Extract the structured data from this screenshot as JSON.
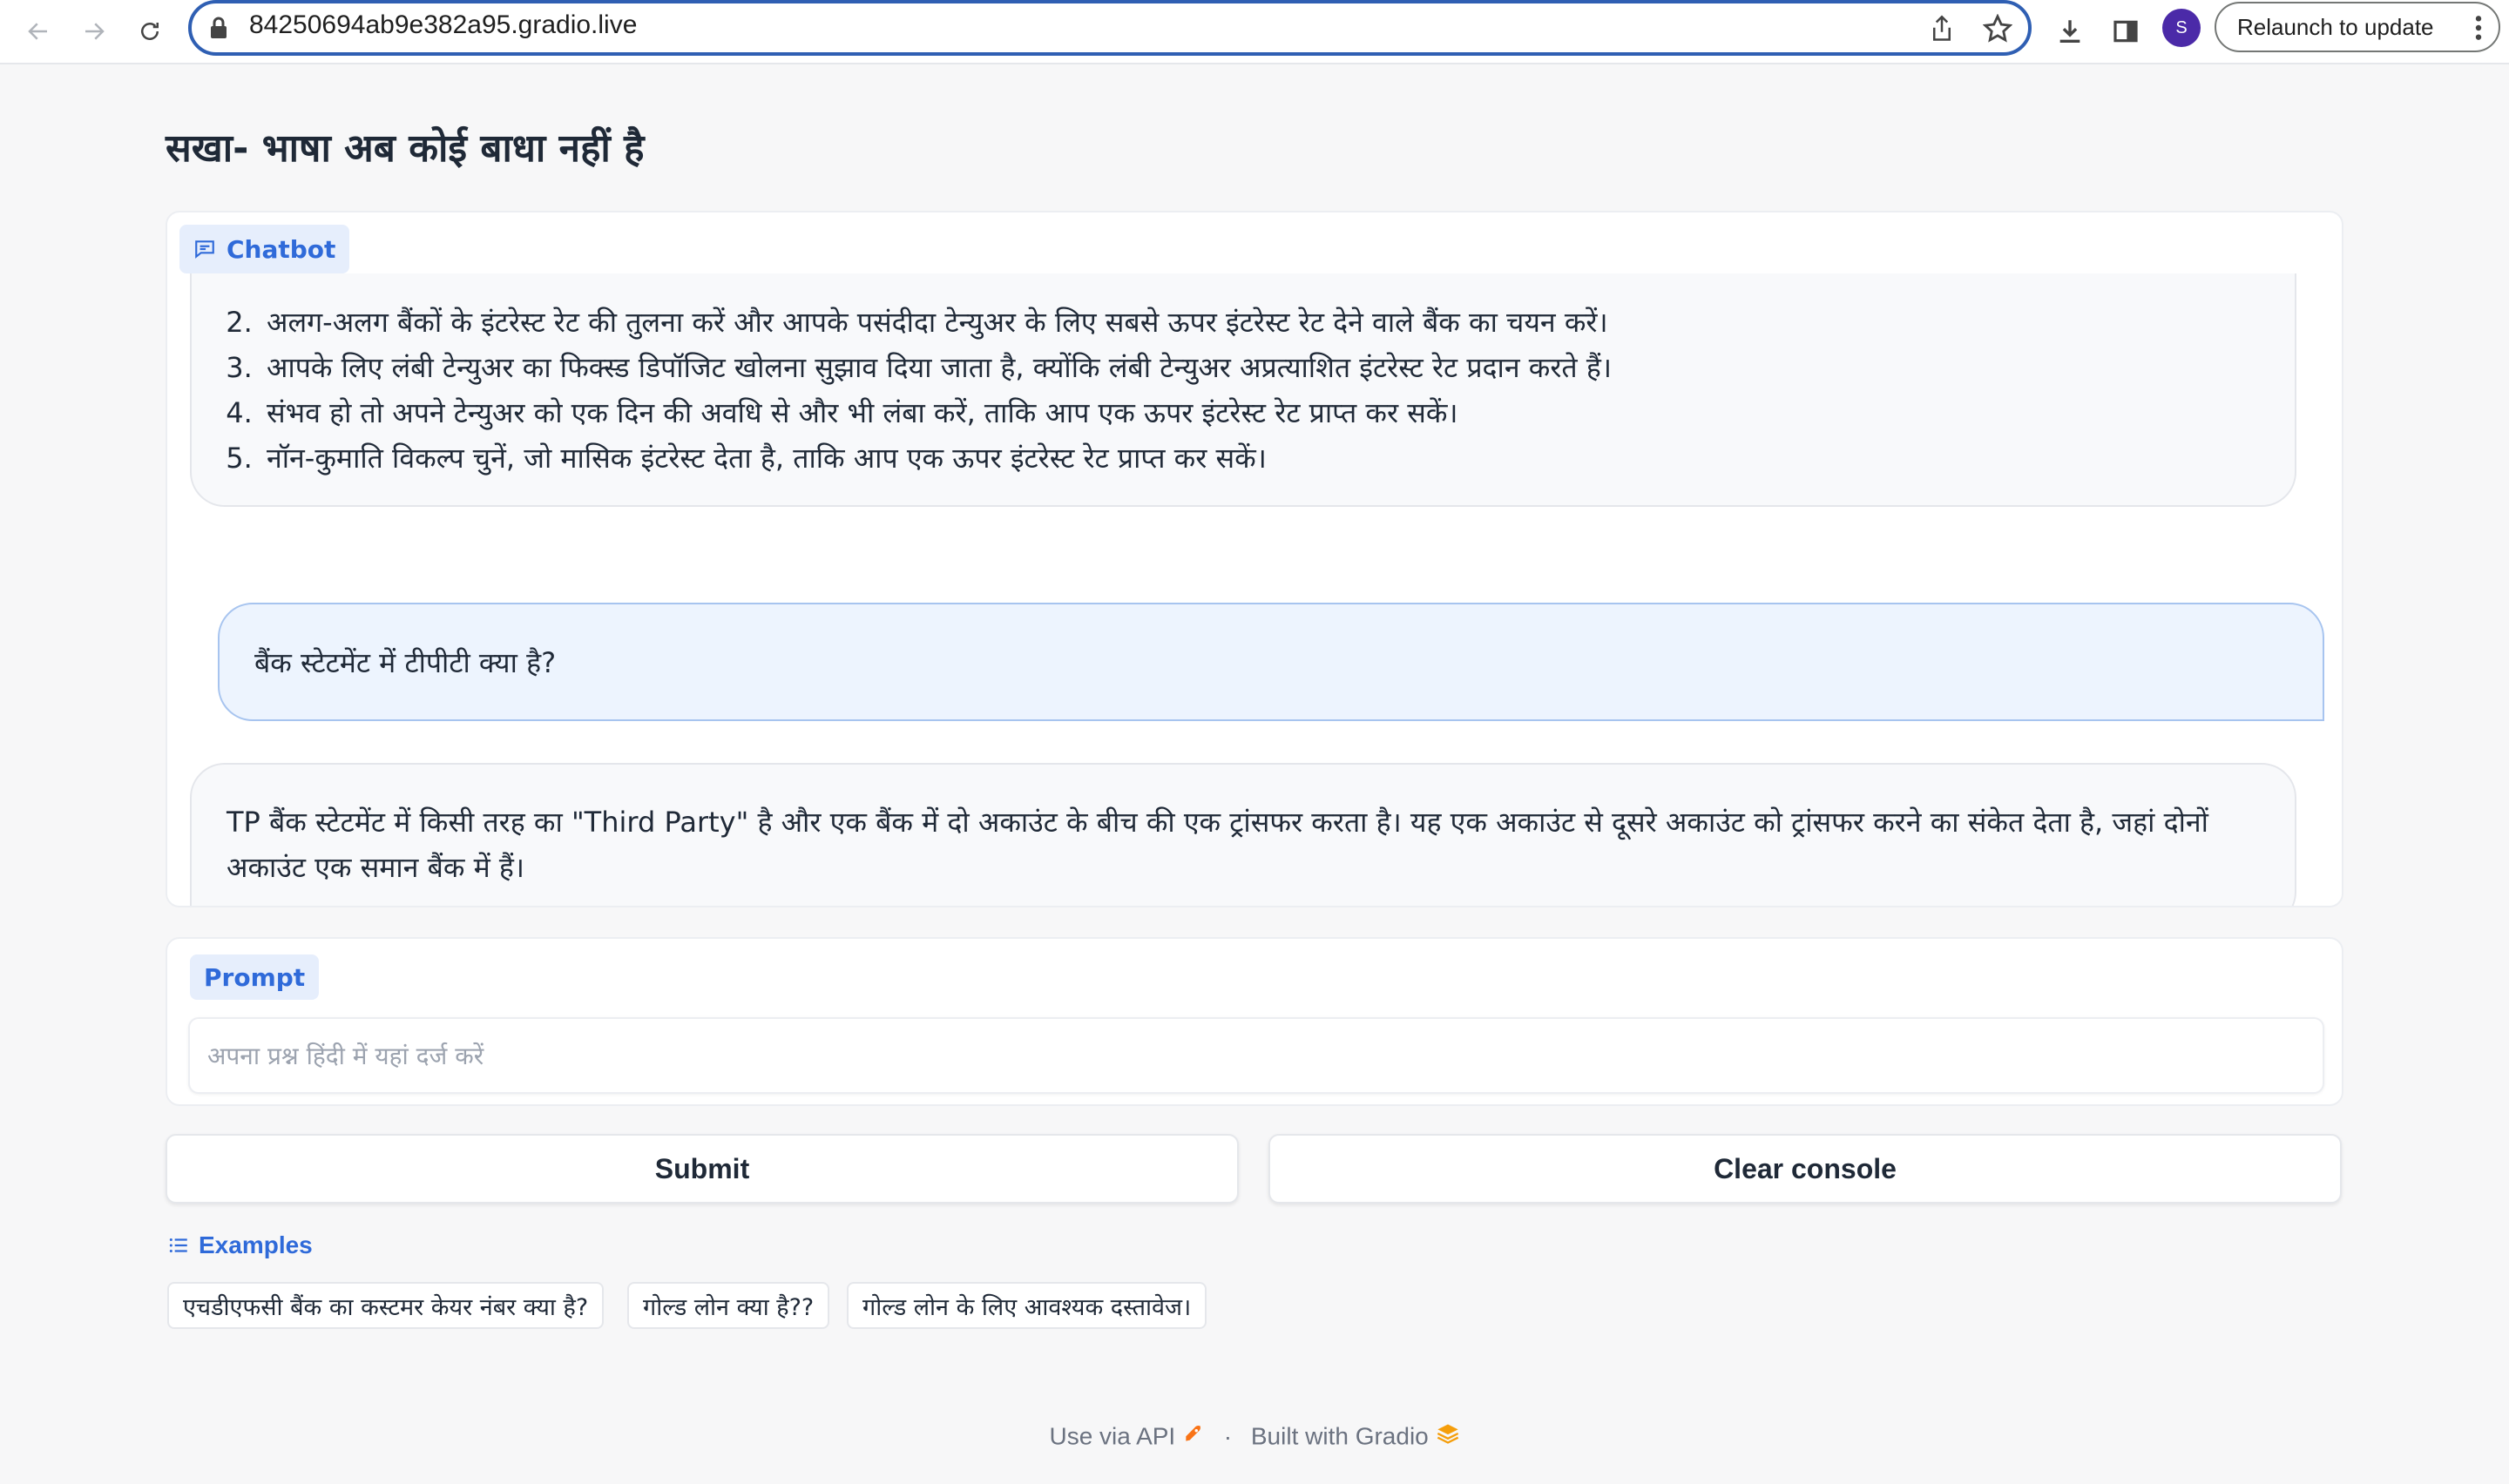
{
  "browser": {
    "url": "84250694ab9e382a95.gradio.live",
    "profile_initial": "S",
    "relaunch_label": "Relaunch to update"
  },
  "page": {
    "title": "सखा- भाषा अब कोई बाधा नहीं है"
  },
  "chatbot": {
    "label": "Chatbot",
    "messages": [
      {
        "role": "bot",
        "items": [
          "अलग-अलग बैंकों के इंटरेस्ट रेट की तुलना करें और आपके पसंदीदा टेन्युअर के लिए सबसे ऊपर इंटरेस्ट रेट देने वाले बैंक का चयन करें।",
          "आपके लिए लंबी टेन्युअर का फिक्स्ड डिपॉजिट खोलना सुझाव दिया जाता है, क्योंकि लंबी टेन्युअर अप्रत्याशित इंटरेस्ट रेट प्रदान करते हैं।",
          "संभव हो तो अपने टेन्युअर को एक दिन की अवधि से और भी लंबा करें, ताकि आप एक ऊपर इंटरेस्ट रेट प्राप्त कर सकें।",
          "नॉन-कुमाति विकल्प चुनें, जो मासिक इंटरेस्ट देता है, ताकि आप एक ऊपर इंटरेस्ट रेट प्राप्त कर सकें।"
        ]
      },
      {
        "role": "user",
        "text": "बैंक स्टेटमेंट में टीपीटी क्या है?"
      },
      {
        "role": "bot",
        "text": "TP बैंक स्टेटमेंट में किसी तरह का \"Third Party\" है और एक बैंक में दो अकाउंट के बीच की एक ट्रांसफर करता है। यह एक अकाउंट से दूसरे अकाउंट को ट्रांसफर करने का संकेत देता है, जहां दोनों अकाउंट एक समान बैंक में हैं।"
      }
    ]
  },
  "prompt": {
    "label": "Prompt",
    "placeholder": "अपना प्रश्न हिंदी में यहां दर्ज करें",
    "value": ""
  },
  "buttons": {
    "submit": "Submit",
    "clear": "Clear console"
  },
  "examples": {
    "label": "Examples",
    "items": [
      "एचडीएफसी बैंक का कस्टमर केयर नंबर क्या है?",
      "गोल्ड लोन क्या है??",
      "गोल्ड लोन के लिए आवश्यक दस्तावेज।"
    ]
  },
  "footer": {
    "api": "Use via API",
    "separator": "·",
    "built": "Built with Gradio"
  },
  "colors": {
    "accent": "#2f6ad9",
    "url_border": "#2f5fb3",
    "user_bubble": "#edf4fe",
    "avatar": "#4b2aa8"
  }
}
